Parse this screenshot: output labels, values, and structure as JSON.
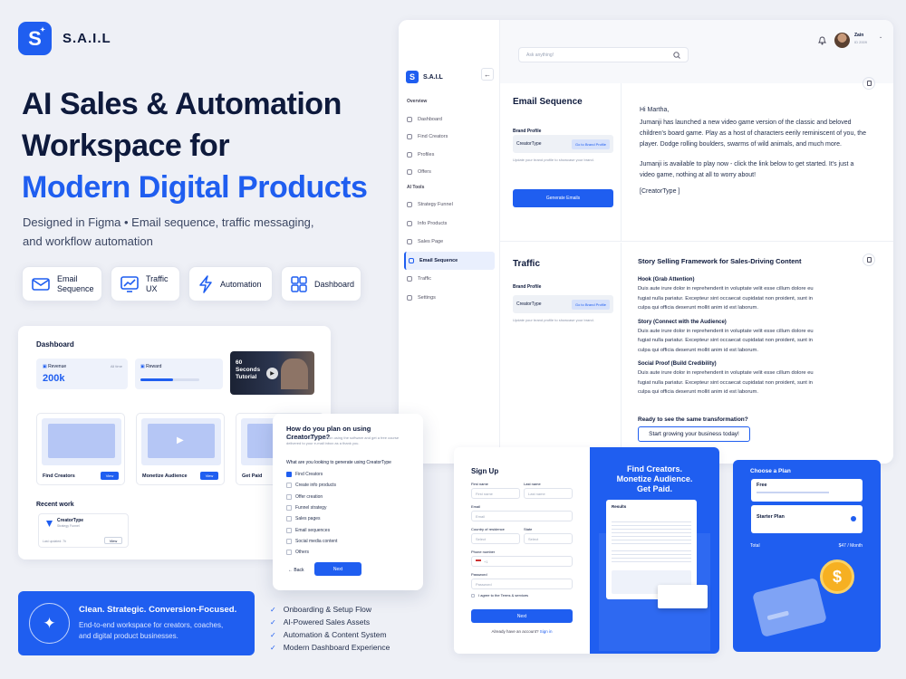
{
  "brand": {
    "name": "S.A.I.L",
    "logo_letter": "S"
  },
  "hero": {
    "title_line1": "AI Sales & Automation",
    "title_line2": "Workspace for",
    "title_line3": "Modern Digital Products",
    "subtitle_line1": "Designed in Figma • Email sequence, traffic messaging,",
    "subtitle_line2": "and workflow automation"
  },
  "features": [
    {
      "label_line1": "Email",
      "label_line2": "Sequence",
      "icon": "mail-icon"
    },
    {
      "label_line1": "Traffic",
      "label_line2": "UX",
      "icon": "chart-icon"
    },
    {
      "label_line1": "Automation",
      "label_line2": "",
      "icon": "bolt-icon"
    },
    {
      "label_line1": "Dashboard",
      "label_line2": "",
      "icon": "grid-icon"
    }
  ],
  "banner": {
    "title": "Clean. Strategic. Conversion-Focused.",
    "desc_line1": "End-to-end workspace for creators, coaches,",
    "desc_line2": "and digital product businesses."
  },
  "checklist": [
    "Onboarding & Setup Flow",
    "AI-Powered Sales Assets",
    "Automation & Content System",
    "Modern Dashboard Experience"
  ],
  "app": {
    "search_placeholder": "Ask anything!",
    "user_name": "Zain",
    "user_sub": "ID 2009",
    "sidebar": {
      "section1": "Overview",
      "items1": [
        "Dashboard",
        "Find Creators",
        "Profiles",
        "Offers"
      ],
      "section2": "AI Tools",
      "items2": [
        "Strategy Funnel",
        "Info Products",
        "Sales Page",
        "Email Sequence",
        "Traffic",
        "Settings"
      ]
    },
    "email": {
      "title": "Email Sequence",
      "brand_label": "Brand Profile",
      "brand_value": "CreatorType",
      "brand_link": "Go to Brand Profile",
      "brand_hint": "Update your brand profile to showcase your brand.",
      "generate": "Generate Emails",
      "greeting": "Hi Martha,",
      "p1": "Jumanji has launched a new video game version of the classic and beloved children's board game. Play as a host of characters eerily reminiscent of you, the player. Dodge rolling boulders, swarms of wild animals, and much more.",
      "p2": "Jumanji is available to play now - click the link below to get started. It's just a video game, nothing at all to worry about!",
      "sign": "[CreatorType ]"
    },
    "traffic": {
      "title": "Traffic",
      "brand_label": "Brand Profile",
      "brand_value": "CreatorType",
      "brand_link": "Go to Brand Profile",
      "brand_hint": "Update your brand profile to showcase your brand.",
      "framework_title": "Story Selling Framework for Sales-Driving Content",
      "sections": [
        {
          "h": "Hook (Grab Attention)",
          "p": "Duis aute irure dolor in reprehenderit in voluptate velit esse cillum dolore eu fugiat nulla pariatur. Excepteur sint occaecat cupidatat non proident, sunt in culpa qui officia deserunt mollit anim id est laborum."
        },
        {
          "h": "Story (Connect with the Audience)",
          "p": "Duis aute irure dolor in reprehenderit in voluptate velit esse cillum dolore eu fugiat nulla pariatur. Excepteur sint occaecat cupidatat non proident, sunt in culpa qui officia deserunt mollit anim id est laborum."
        },
        {
          "h": "Social Proof (Build Credibility)",
          "p": "Duis aute irure dolor in reprehenderit in voluptate velit esse cillum dolore eu fugiat nulla pariatur. Excepteur sint occaecat cupidatat non proident, sunt in culpa qui officia deserunt mollit anim id est laborum."
        }
      ],
      "cta_question": "Ready to see the same transformation?",
      "cta_button": "Start growing your business today!"
    }
  },
  "dashboard": {
    "title": "Dashboard",
    "revenue_label": "Revenue",
    "revenue_value": "200k",
    "revenue_filter": "All time",
    "reward_label": "Reward",
    "reward_progress": 0.55,
    "video_line1": "60",
    "video_line2": "Seconds",
    "video_line3": "Tutorial",
    "cards": [
      {
        "label": "Find Creators",
        "btn": "View"
      },
      {
        "label": "Monetize Audience",
        "btn": "View"
      },
      {
        "label": "Get Paid",
        "btn": "View"
      }
    ],
    "recent_title": "Recent work",
    "recent_name": "CreatorType",
    "recent_sub": "Strategy Funnel",
    "recent_updated": "Last updated: 7h",
    "recent_btn": "View"
  },
  "survey": {
    "title": "How do you plan on using CreatorType?",
    "desc": "Let us know how you plan on using the software and get a free course delivered to your e-mail inbox as a thank you.",
    "question": "What are you looking to generate using CreatorType",
    "options": [
      {
        "label": "Find Creators",
        "checked": true
      },
      {
        "label": "Create info products",
        "checked": false
      },
      {
        "label": "Offer creation",
        "checked": false
      },
      {
        "label": "Funnel strategy",
        "checked": false
      },
      {
        "label": "Sales pages",
        "checked": false
      },
      {
        "label": "Email sequences",
        "checked": false
      },
      {
        "label": "Social media content",
        "checked": false
      },
      {
        "label": "Others",
        "checked": false
      }
    ],
    "back": "Back",
    "next": "Next"
  },
  "signup": {
    "title": "Sign Up",
    "first_label": "First name",
    "first_ph": "First name",
    "last_label": "Last name",
    "last_ph": "Last name",
    "email_label": "Email",
    "email_ph": "Email",
    "country_label": "Country of residence",
    "country_ph": "Select",
    "state_label": "State",
    "state_ph": "Select",
    "phone_label": "Phone number",
    "phone_ph": "+1",
    "password_label": "Password",
    "password_ph": "Password",
    "agree": "I agree to the Terms & services",
    "next": "Next",
    "have_account": "Already have an account?",
    "sign_in": "Sign in",
    "promo_line1": "Find Creators.",
    "promo_line2": "Monetize Audience.",
    "promo_line3": "Get Paid.",
    "results_label": "Results"
  },
  "plan": {
    "title": "Choose a Plan",
    "free_name": "Free",
    "starter_name": "Starter Plan",
    "total_label": "Total",
    "total_value": "$47 / Month",
    "coin_symbol": "$"
  },
  "colors": {
    "accent": "#1f5ef0",
    "ink": "#0e1a3c",
    "bg": "#eef0f6"
  }
}
